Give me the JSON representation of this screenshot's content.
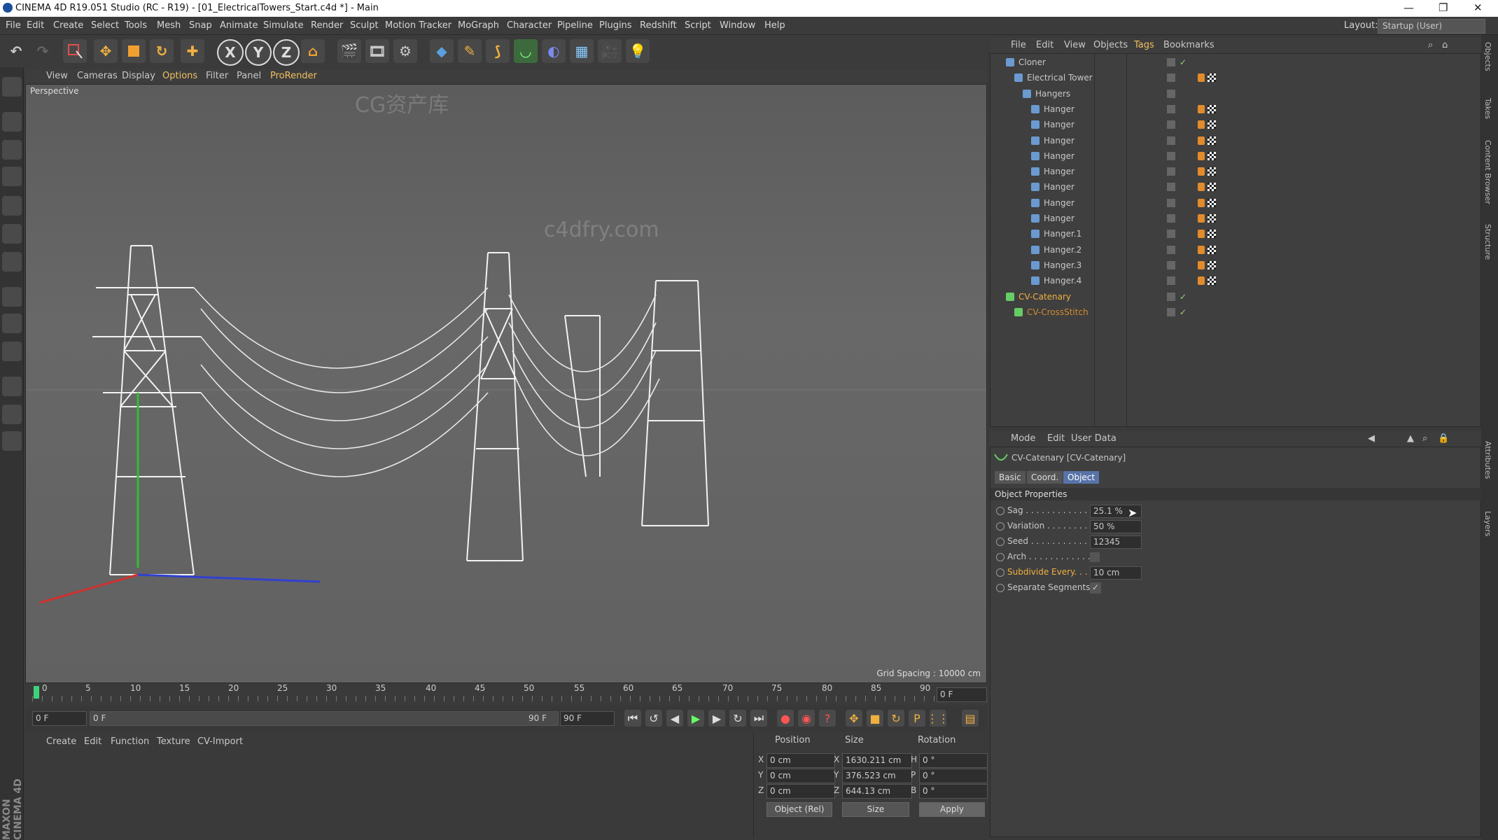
{
  "window": {
    "title": "CINEMA 4D R19.051 Studio (RC - R19) - [01_ElectricalTowers_Start.c4d *] - Main"
  },
  "menu": [
    "File",
    "Edit",
    "Create",
    "Select",
    "Tools",
    "Mesh",
    "Snap",
    "Animate",
    "Simulate",
    "Render",
    "Sculpt",
    "Motion Tracker",
    "MoGraph",
    "Character",
    "Pipeline",
    "Plugins",
    "Redshift",
    "Script",
    "Window",
    "Help"
  ],
  "layout": {
    "label": "Layout:",
    "value": "Startup (User)"
  },
  "viewport": {
    "menu": [
      "View",
      "Cameras",
      "Display",
      "Options",
      "Filter",
      "Panel",
      "ProRender"
    ],
    "label": "Perspective",
    "grid_spacing": "Grid Spacing : 10000 cm"
  },
  "timeline": {
    "ticks": [
      "0",
      "5",
      "10",
      "15",
      "20",
      "25",
      "30",
      "35",
      "40",
      "45",
      "50",
      "55",
      "60",
      "65",
      "70",
      "75",
      "80",
      "85",
      "90"
    ],
    "current_frame": "0 F",
    "start": "0 F",
    "range_start": "0 F",
    "range_end": "90 F",
    "end": "90 F"
  },
  "material_menu": [
    "Create",
    "Edit",
    "Function",
    "Texture",
    "CV-Import"
  ],
  "coords": {
    "headers": [
      "Position",
      "Size",
      "Rotation"
    ],
    "rows": [
      {
        "axis": "X",
        "pos": "0 cm",
        "size_axis": "X",
        "size": "1630.211 cm",
        "rot_axis": "H",
        "rot": "0 °"
      },
      {
        "axis": "Y",
        "pos": "0 cm",
        "size_axis": "Y",
        "size": "376.523 cm",
        "rot_axis": "P",
        "rot": "0 °"
      },
      {
        "axis": "Z",
        "pos": "0 cm",
        "size_axis": "Z",
        "size": "644.13 cm",
        "rot_axis": "B",
        "rot": "0 °"
      }
    ],
    "mode": "Object (Rel)",
    "size_mode": "Size",
    "apply": "Apply"
  },
  "object_manager": {
    "menu": [
      "File",
      "Edit",
      "View",
      "Objects",
      "Tags",
      "Bookmarks"
    ],
    "objects": [
      {
        "name": "Cloner",
        "indent": 0,
        "color": "#c8c8c8"
      },
      {
        "name": "Electrical Tower",
        "indent": 1,
        "color": "#c8c8c8"
      },
      {
        "name": "Hangers",
        "indent": 2,
        "color": "#c8c8c8"
      },
      {
        "name": "Hanger",
        "indent": 3,
        "color": "#c8c8c8"
      },
      {
        "name": "Hanger",
        "indent": 3,
        "color": "#c8c8c8"
      },
      {
        "name": "Hanger",
        "indent": 3,
        "color": "#c8c8c8"
      },
      {
        "name": "Hanger",
        "indent": 3,
        "color": "#c8c8c8"
      },
      {
        "name": "Hanger",
        "indent": 3,
        "color": "#c8c8c8"
      },
      {
        "name": "Hanger",
        "indent": 3,
        "color": "#c8c8c8"
      },
      {
        "name": "Hanger",
        "indent": 3,
        "color": "#c8c8c8"
      },
      {
        "name": "Hanger",
        "indent": 3,
        "color": "#c8c8c8"
      },
      {
        "name": "Hanger.1",
        "indent": 3,
        "color": "#c8c8c8"
      },
      {
        "name": "Hanger.2",
        "indent": 3,
        "color": "#c8c8c8"
      },
      {
        "name": "Hanger.3",
        "indent": 3,
        "color": "#c8c8c8"
      },
      {
        "name": "Hanger.4",
        "indent": 3,
        "color": "#c8c8c8"
      },
      {
        "name": "CV-Catenary",
        "indent": 0,
        "color": "#f0b040"
      },
      {
        "name": "CV-CrossStitch",
        "indent": 1,
        "color": "#d08a30"
      }
    ]
  },
  "attributes": {
    "menu": [
      "Mode",
      "Edit",
      "User Data"
    ],
    "object_title": "CV-Catenary [CV-Catenary]",
    "tabs": [
      "Basic",
      "Coord.",
      "Object"
    ],
    "active_tab": "Object",
    "section": "Object Properties",
    "props": [
      {
        "label": "Sag . . . . . . . . . . . . . . .",
        "value": "25.1 %"
      },
      {
        "label": "Variation . . . . . . . . .",
        "value": "50 %"
      },
      {
        "label": "Seed . . . . . . . . . . . . .",
        "value": "12345"
      },
      {
        "label": "Arch . . . . . . . . . . . . .",
        "value": ""
      },
      {
        "label": "Subdivide Every. . . .",
        "value": "10 cm"
      },
      {
        "label": "Separate Segments",
        "value": "✓"
      }
    ]
  },
  "right_tabs": [
    "Objects",
    "Takes",
    "Content Browser",
    "Structure",
    "Attributes",
    "Layers"
  ],
  "brand": "MAXON CINEMA 4D",
  "watermarks": [
    "c4dfry.com",
    "CG资产库"
  ]
}
